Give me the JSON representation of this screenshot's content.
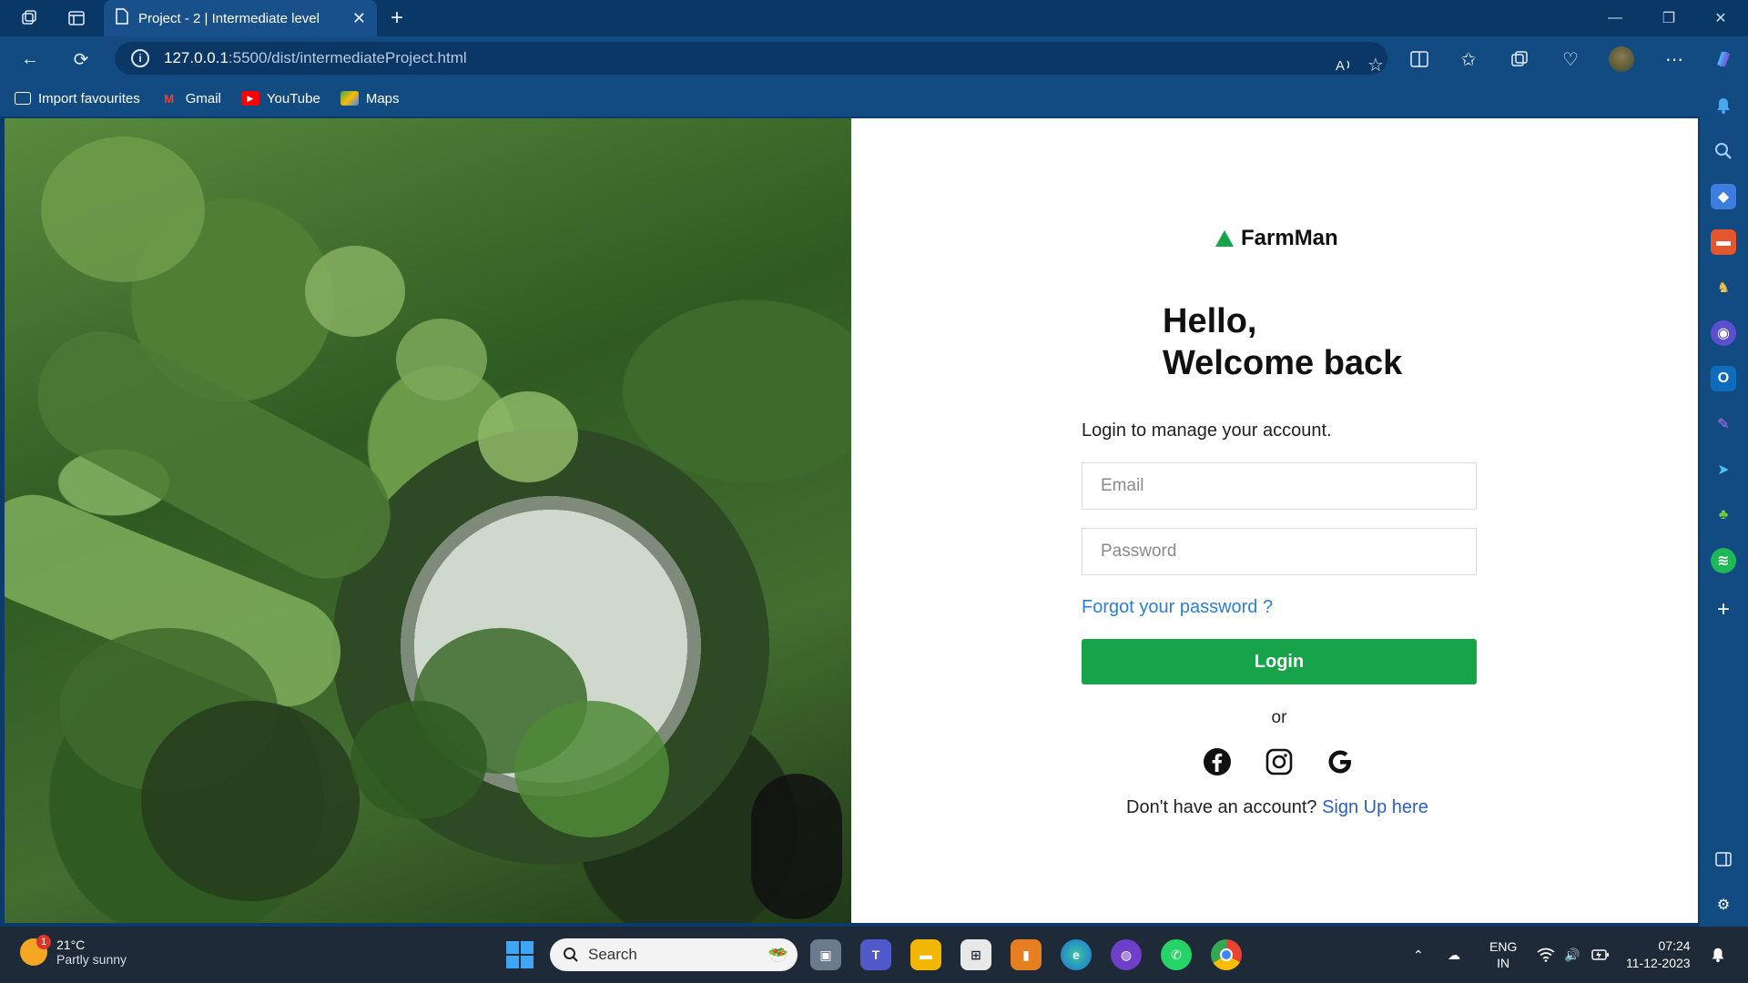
{
  "browser": {
    "tab_title": "Project - 2 | Intermediate level",
    "url_host": "127.0.0.1",
    "url_path": ":5500/dist/intermediateProject.html",
    "bookmarks": [
      "Import favourites",
      "Gmail",
      "YouTube",
      "Maps"
    ]
  },
  "page": {
    "brand": "FarmMan",
    "greeting_line1": "Hello,",
    "greeting_line2": "Welcome back",
    "subtitle": "Login to manage your account.",
    "email_placeholder": "Email",
    "password_placeholder": "Password",
    "forgot_label": "Forgot your password ?",
    "login_label": "Login",
    "or_label": "or",
    "signup_prompt": "Don't have an account?",
    "signup_link": "Sign Up here",
    "accent_color": "#16a34a",
    "social": [
      "facebook-icon",
      "instagram-icon",
      "google-icon"
    ]
  },
  "taskbar": {
    "temperature": "21°C",
    "weather_text": "Partly sunny",
    "weather_badge": "1",
    "search_label": "Search",
    "lang_top": "ENG",
    "lang_bottom": "IN",
    "time": "07:24",
    "date": "11-12-2023"
  }
}
